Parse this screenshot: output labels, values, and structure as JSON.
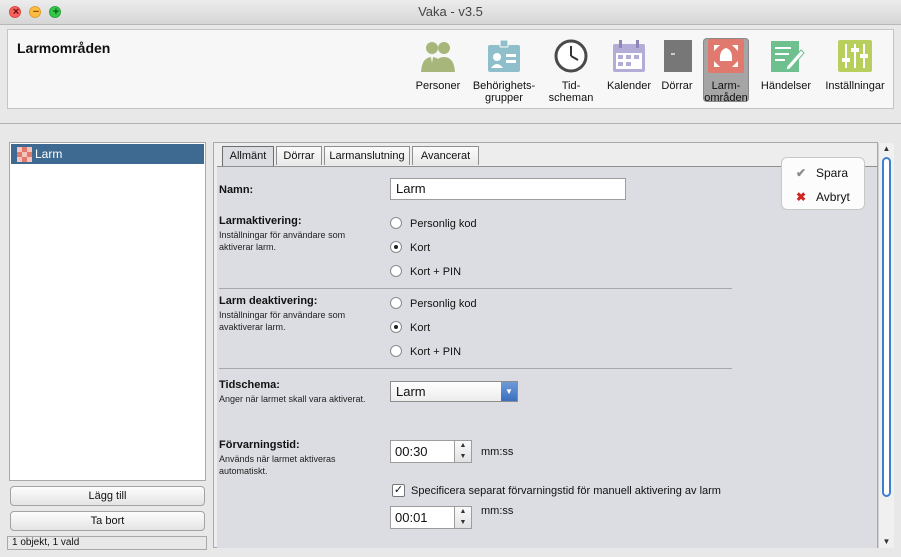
{
  "window": {
    "title": "Vaka - v3.5",
    "controls": {
      "close": "×",
      "minimize": "−",
      "maximize": "+"
    }
  },
  "header": {
    "page_title": "Larmområden",
    "toolbar": [
      {
        "label": "Personer",
        "icon": "users-icon"
      },
      {
        "label": "Behörighets-\ngrupper",
        "icon": "id-card-icon"
      },
      {
        "label": "Tid-\nscheman",
        "icon": "clock-icon"
      },
      {
        "label": "Kalender",
        "icon": "calendar-icon"
      },
      {
        "label": "Dörrar",
        "icon": "door-icon"
      },
      {
        "label": "Larm-\nområden",
        "icon": "alarm-area-icon",
        "active": true
      },
      {
        "label": "Händelser",
        "icon": "edit-note-icon"
      },
      {
        "label": "Inställningar",
        "icon": "sliders-icon"
      }
    ]
  },
  "list": {
    "items": [
      {
        "label": "Larm",
        "selected": true,
        "icon": "alarm-area-icon"
      }
    ],
    "add_button": "Lägg till",
    "remove_button": "Ta bort",
    "status": "1 objekt, 1 vald"
  },
  "tabs": [
    {
      "label": "Allmänt",
      "active": true
    },
    {
      "label": "Dörrar"
    },
    {
      "label": "Larmanslutning"
    },
    {
      "label": "Avancerat"
    }
  ],
  "form": {
    "name": {
      "label": "Namn:",
      "value": "Larm"
    },
    "activation": {
      "label": "Larmaktivering:",
      "description": "Inställningar för användare som aktiverar larm.",
      "options": [
        "Personlig kod",
        "Kort",
        "Kort + PIN"
      ],
      "selected": "Kort"
    },
    "deactivation": {
      "label": "Larm deaktivering:",
      "description": "Inställningar för användare som avaktiverar larm.",
      "options": [
        "Personlig kod",
        "Kort",
        "Kort + PIN"
      ],
      "selected": "Kort"
    },
    "schedule": {
      "label": "Tidschema:",
      "description": "Anger när larmet skall vara aktiverat.",
      "value": "Larm"
    },
    "delay": {
      "label": "Förvarningstid:",
      "description": "Används när larmet aktiveras automatiskt.",
      "value": "00:30",
      "unit": "mm:ss",
      "separate_checkbox": {
        "label": "Specificera separat förvarningstid för manuell aktivering av larm",
        "checked": true
      },
      "manual_value": "00:01",
      "manual_unit": "mm:ss"
    }
  },
  "actions": {
    "save": "Spara",
    "cancel": "Avbryt"
  },
  "colors": {
    "selection": "#3e6a91",
    "form_bg": "#dcdde3",
    "combo_arrow": "#3a6fbf"
  }
}
